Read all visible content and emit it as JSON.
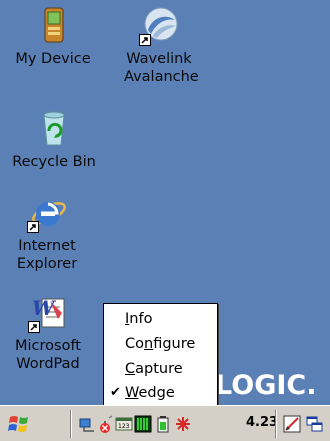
{
  "desktop": {
    "icons": [
      {
        "label": "My Device",
        "icon": "my-device-icon"
      },
      {
        "label": "Wavelink Avalanche",
        "icon": "wavelink-avalanche-icon"
      },
      {
        "label": "Recycle Bin",
        "icon": "recycle-bin-icon"
      },
      {
        "label": "Internet Explorer",
        "icon": "internet-explorer-icon"
      },
      {
        "label": "Microsoft WordPad",
        "icon": "wordpad-icon"
      }
    ],
    "watermark": "LOGIC."
  },
  "context_menu": {
    "items": [
      {
        "label_pre": "",
        "label_u": "I",
        "label_post": "nfo",
        "checked": false
      },
      {
        "label_pre": "Co",
        "label_u": "n",
        "label_post": "figure",
        "checked": false
      },
      {
        "label_pre": "",
        "label_u": "C",
        "label_post": "apture",
        "checked": false
      },
      {
        "label_pre": "",
        "label_u": "W",
        "label_post": "edge",
        "checked": true
      }
    ],
    "check_mark": "✔"
  },
  "taskbar": {
    "clock": "4.23",
    "tray_icons": [
      "network-icon",
      "wireless-icon",
      "keyboard-123-icon",
      "battery-bars-icon",
      "battery-icon",
      "scanner-icon",
      "pen-icon",
      "windows-switch-icon"
    ]
  },
  "colors": {
    "desktop": "#5b80b5",
    "taskbar": "#d4d0c8"
  }
}
